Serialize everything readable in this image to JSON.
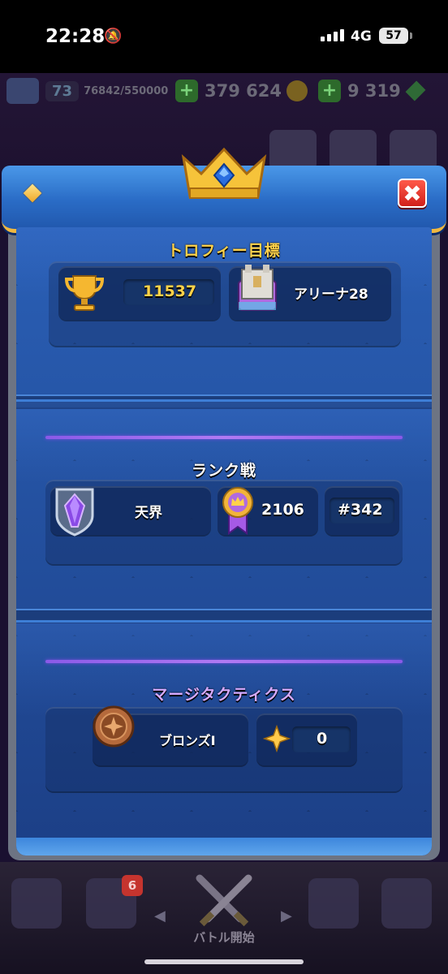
{
  "status_bar": {
    "time": "22:28",
    "network": "4G",
    "battery": "57"
  },
  "hud": {
    "level": "73",
    "xp": "76842/550000",
    "gold": "379 624",
    "gems": "9 319",
    "plus": "+"
  },
  "modal": {
    "close_label": "✖",
    "trophy_section": {
      "title": "トロフィー目標",
      "trophies": "11537",
      "arena": "アリーナ28"
    },
    "ranked_section": {
      "title": "ランク戦",
      "league": "天界",
      "rating": "2106",
      "rank": "#342"
    },
    "merge_section": {
      "title": "マージタクティクス",
      "league": "ブロンズI",
      "score": "0"
    }
  },
  "bottom_nav": {
    "cards_badge": "6",
    "battle_label": "バトル開始",
    "left_arrow": "◀",
    "right_arrow": "▶"
  },
  "colors": {
    "accent_gold": "#ffd24a",
    "panel_blue": "#1f4994",
    "purple_line": "#b07af2",
    "close_red": "#d0201a"
  },
  "icons": [
    "diamond-icon",
    "crown-icon",
    "close-icon",
    "trophy-icon",
    "arena-icon",
    "league-crystal-icon",
    "medal-icon",
    "bronze-badge-icon",
    "sparkle-icon"
  ]
}
